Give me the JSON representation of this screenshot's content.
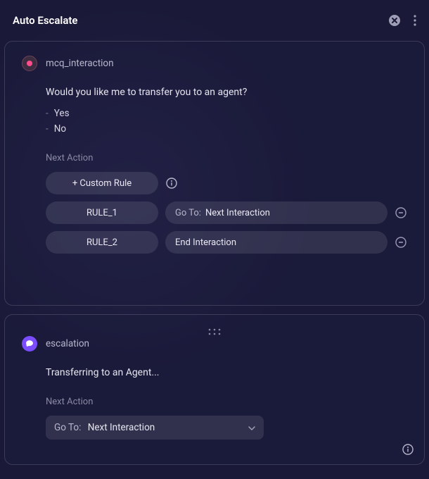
{
  "header": {
    "title": "Auto Escalate"
  },
  "card1": {
    "node_name": "mcq_interaction",
    "question": "Would you like me to transfer you to an agent?",
    "options": [
      "Yes",
      "No"
    ],
    "next_action_label": "Next Action",
    "custom_rule_label": "+ Custom Rule",
    "rules": [
      {
        "name": "RULE_1",
        "goto_prefix": "Go To:",
        "goto_value": "Next Interaction"
      },
      {
        "name": "RULE_2",
        "action": "End Interaction"
      }
    ]
  },
  "card2": {
    "node_name": "escalation",
    "message": "Transferring to an Agent...",
    "next_action_label": "Next Action",
    "goto_prefix": "Go To:",
    "goto_value": "Next Interaction"
  }
}
